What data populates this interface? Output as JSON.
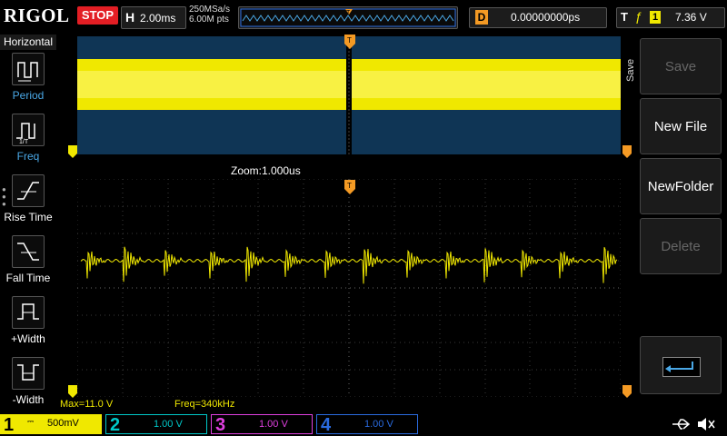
{
  "top": {
    "brand": "RIGOL",
    "run_state": "STOP",
    "h_key": "H",
    "timebase": "2.00ms",
    "sample_rate": "250MSa/s",
    "memory_depth": "6.00M pts",
    "trigger_marker": "T",
    "d_key": "D",
    "delay": "0.00000000ps",
    "t_key": "T",
    "trigger_channel": "1",
    "trigger_level": "7.36 V"
  },
  "left_menu": {
    "title": "Horizontal",
    "items": [
      {
        "label": "Period",
        "icon": "period-icon",
        "active": false
      },
      {
        "label": "Freq",
        "icon": "freq-icon",
        "active": false
      },
      {
        "label": "Rise Time",
        "icon": "rise-time-icon",
        "active": true
      },
      {
        "label": "Fall Time",
        "icon": "fall-time-icon",
        "active": true
      },
      {
        "label": "+Width",
        "icon": "pos-width-icon",
        "active": true
      },
      {
        "label": "-Width",
        "icon": "neg-width-icon",
        "active": true
      }
    ]
  },
  "right_menu": {
    "tab": "Save",
    "buttons": [
      {
        "label": "Save",
        "enabled": false
      },
      {
        "label": "New File",
        "enabled": true
      },
      {
        "label": "NewFolder",
        "enabled": true
      },
      {
        "label": "Delete",
        "enabled": false
      }
    ],
    "enter_icon": "enter-icon"
  },
  "display": {
    "zoom_label": "Zoom:1.000us",
    "max_label": "Max=11.0 V",
    "freq_label": "Freq=340kHz"
  },
  "channels": [
    {
      "num": "1",
      "value": "500mV",
      "color": "#f0e800",
      "active": true
    },
    {
      "num": "2",
      "value": "1.00 V",
      "color": "#00c8c8",
      "active": false
    },
    {
      "num": "3",
      "value": "1.00 V",
      "color": "#e040e0",
      "active": false
    },
    {
      "num": "4",
      "value": "1.00 V",
      "color": "#2a6be0",
      "active": false
    }
  ],
  "status_icons": [
    "usb-icon",
    "mute-icon"
  ],
  "colors": {
    "ch1": "#f0e800",
    "trigger": "#f49a24",
    "upper_bg": "#0f3555"
  }
}
